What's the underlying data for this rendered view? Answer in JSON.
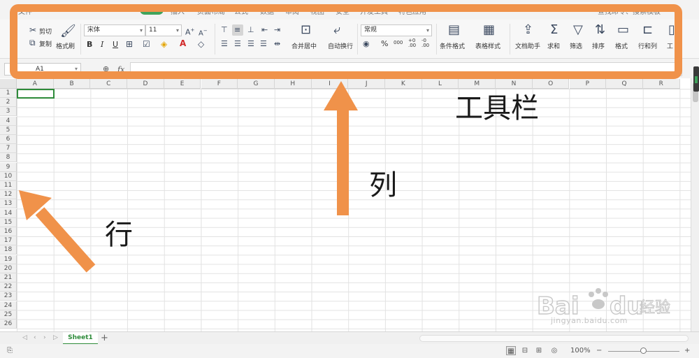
{
  "menu": {
    "items": [
      "文件",
      "开始",
      "插入",
      "页面布局",
      "公式",
      "数据",
      "审阅",
      "视图",
      "安全",
      "开发工具",
      "特色应用"
    ],
    "active": "开始",
    "search": "查找命令、搜索模板"
  },
  "ribbon": {
    "cut": "剪切",
    "copy": "复制",
    "format_painter": "格式刷",
    "font_name": "宋体",
    "font_size": "11",
    "bold": "B",
    "italic": "I",
    "underline": "U",
    "merge_center": "合并居中",
    "wrap_text": "自动换行",
    "number_format": "常规",
    "percent": "%",
    "thousands": "000",
    "inc_decimal": "+0 .00",
    "dec_decimal": "-0 .00",
    "conditional_format": "条件格式",
    "table_style": "表格样式",
    "doc_helper": "文档助手",
    "sum": "求和",
    "filter": "筛选",
    "sort": "排序",
    "format": "格式",
    "rows_cols": "行和列",
    "worksheet": "工"
  },
  "formula_bar": {
    "name_box": "A1",
    "fx": "fx",
    "value": ""
  },
  "grid": {
    "columns": [
      "A",
      "B",
      "C",
      "D",
      "E",
      "F",
      "G",
      "H",
      "I",
      "J",
      "K",
      "L",
      "M",
      "N",
      "O",
      "P",
      "Q",
      "R"
    ],
    "rows": [
      "1",
      "2",
      "3",
      "4",
      "5",
      "6",
      "7",
      "8",
      "9",
      "10",
      "11",
      "12",
      "13",
      "14",
      "15",
      "16",
      "17",
      "18",
      "19",
      "20",
      "21",
      "22",
      "23",
      "24",
      "25",
      "26"
    ],
    "active_cell": "A1"
  },
  "sheets": {
    "tabs": [
      "Sheet1"
    ],
    "add": "+"
  },
  "status_bar": {
    "zoom": "100%",
    "minus": "−",
    "plus": "+"
  },
  "annotations": {
    "toolbar": "工具栏",
    "column": "列",
    "row": "行",
    "color": "#f0924a"
  },
  "watermark": {
    "brand": "Baidu经验",
    "url": "jingyan.baidu.com"
  }
}
